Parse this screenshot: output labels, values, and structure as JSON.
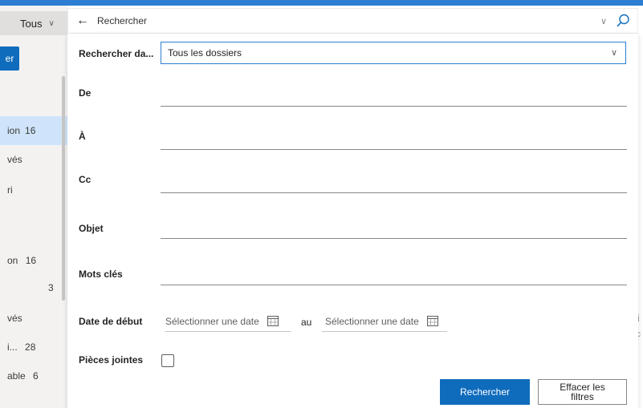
{
  "scope": {
    "label": "Tous"
  },
  "left_pane": {
    "new_button_label": "er",
    "items": [
      {
        "label": "ion",
        "count": "16"
      },
      {
        "label": "vés",
        "count": ""
      },
      {
        "label": "ri",
        "count": ""
      },
      {
        "label": "on",
        "count": "16"
      },
      {
        "label": "",
        "count": "3"
      },
      {
        "label": "vés",
        "count": ""
      },
      {
        "label": "i...",
        "count": "28"
      },
      {
        "label": "able",
        "count": "6"
      }
    ]
  },
  "right_fragment": {
    "text1": "i",
    "text2": "c"
  },
  "search_bar": {
    "query": "Rechercher"
  },
  "panel": {
    "search_in_label": "Rechercher da...",
    "search_in_value": "Tous les dossiers",
    "from_label": "De",
    "to_label": "À",
    "cc_label": "Cc",
    "subject_label": "Objet",
    "keywords_label": "Mots clés",
    "start_date_label": "Date de début",
    "date_placeholder": "Sélectionner une date",
    "date_to_label": "au",
    "attachments_label": "Pièces jointes",
    "search_button": "Rechercher",
    "clear_button": "Effacer les filtres"
  },
  "colors": {
    "accent": "#0f6cbd",
    "top_strip": "#2d7dd2",
    "selected_bg": "#cfe4fa"
  }
}
